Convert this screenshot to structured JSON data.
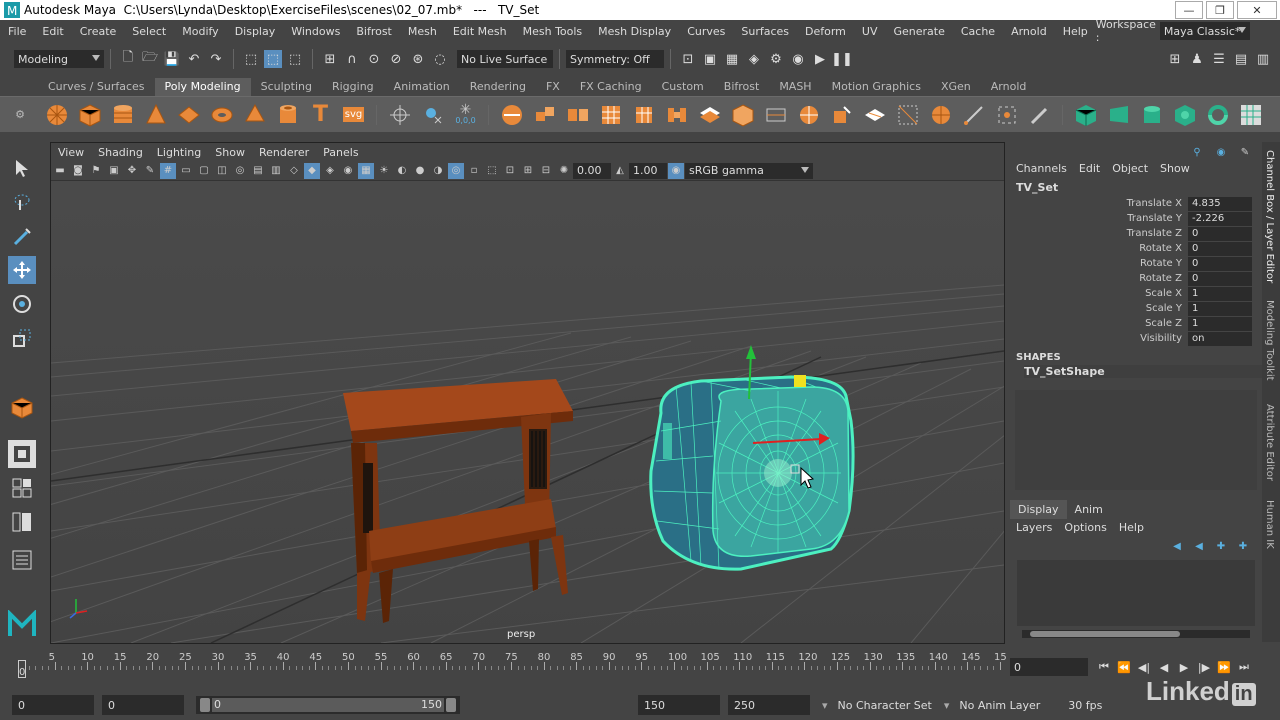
{
  "window": {
    "title": "Autodesk Maya  C:\\Users\\Lynda\\Desktop\\ExerciseFiles\\scenes\\02_07.mb*   ---   TV_Set",
    "minimize": "—",
    "maximize": "❐",
    "close": "✕"
  },
  "menubar": {
    "items": [
      "File",
      "Edit",
      "Create",
      "Select",
      "Modify",
      "Display",
      "Windows",
      "Bifrost",
      "Mesh",
      "Edit Mesh",
      "Mesh Tools",
      "Mesh Display",
      "Curves",
      "Surfaces",
      "Deform",
      "UV",
      "Generate",
      "Cache",
      "Arnold",
      "Help"
    ],
    "workspace_label": "Workspace :",
    "workspace_value": "Maya Classic*"
  },
  "statusline": {
    "mode": "Modeling",
    "live_surface": "No Live Surface",
    "symmetry": "Symmetry: Off"
  },
  "shelf": {
    "tabs": [
      "Curves / Surfaces",
      "Poly Modeling",
      "Sculpting",
      "Rigging",
      "Animation",
      "Rendering",
      "FX",
      "FX Caching",
      "Custom",
      "Bifrost",
      "MASH",
      "Motion Graphics",
      "XGen",
      "Arnold"
    ],
    "active_tab": "Poly Modeling",
    "svg_label": "svg",
    "zero_label": "0,0,0"
  },
  "viewport": {
    "menu": [
      "View",
      "Shading",
      "Lighting",
      "Show",
      "Renderer",
      "Panels"
    ],
    "field_a": "0.00",
    "field_b": "1.00",
    "color_space": "sRGB gamma",
    "camera": "persp"
  },
  "channel_box": {
    "menu": [
      "Channels",
      "Edit",
      "Object",
      "Show"
    ],
    "object": "TV_Set",
    "attributes": [
      {
        "name": "Translate X",
        "value": "4.835"
      },
      {
        "name": "Translate Y",
        "value": "-2.226"
      },
      {
        "name": "Translate Z",
        "value": "0"
      },
      {
        "name": "Rotate X",
        "value": "0"
      },
      {
        "name": "Rotate Y",
        "value": "0"
      },
      {
        "name": "Rotate Z",
        "value": "0"
      },
      {
        "name": "Scale X",
        "value": "1"
      },
      {
        "name": "Scale Y",
        "value": "1"
      },
      {
        "name": "Scale Z",
        "value": "1"
      },
      {
        "name": "Visibility",
        "value": "on"
      }
    ],
    "shapes_header": "SHAPES",
    "shape_name": "TV_SetShape"
  },
  "layer_editor": {
    "tabs": [
      "Display",
      "Anim"
    ],
    "menu": [
      "Layers",
      "Options",
      "Help"
    ]
  },
  "side_tabs": [
    "Channel Box / Layer Editor",
    "Modeling Toolkit",
    "Attribute Editor",
    "Human IK"
  ],
  "timeline": {
    "ticks": [
      "5",
      "10",
      "15",
      "20",
      "25",
      "30",
      "35",
      "40",
      "45",
      "50",
      "55",
      "60",
      "65",
      "70",
      "75",
      "80",
      "85",
      "90",
      "95",
      "100",
      "105",
      "110",
      "115",
      "120",
      "125",
      "130",
      "135",
      "140",
      "145",
      "15"
    ],
    "current_frame_marker": "0",
    "current_frame": "0"
  },
  "range": {
    "start": "0",
    "playback_start": "0",
    "range_start": "0",
    "range_end": "150",
    "playback_end": "150",
    "end": "250",
    "character_set": "No Character Set",
    "anim_layer": "No Anim Layer",
    "fps": "30 fps"
  },
  "watermark": {
    "text": "Linked",
    "in": "in"
  },
  "colors": {
    "selection_wireframe": "#4cf0c0",
    "furniture_wood": "#8a3d14",
    "tool_active": "#5a8fbf"
  }
}
